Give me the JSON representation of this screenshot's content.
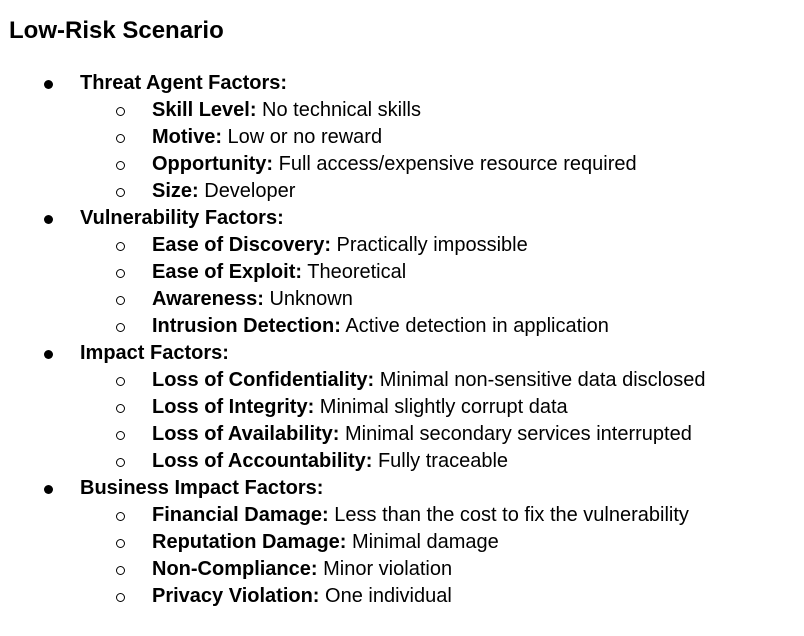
{
  "title": "Low-Risk Scenario",
  "sections": [
    {
      "heading": "Threat Agent Factors:",
      "items": [
        {
          "label": "Skill Level:",
          "value": " No technical skills"
        },
        {
          "label": "Motive:",
          "value": " Low or no reward"
        },
        {
          "label": "Opportunity:",
          "value": " Full access/expensive resource required"
        },
        {
          "label": "Size:",
          "value": " Developer"
        }
      ]
    },
    {
      "heading": "Vulnerability Factors:",
      "items": [
        {
          "label": "Ease of Discovery:",
          "value": " Practically impossible"
        },
        {
          "label": "Ease of Exploit:",
          "value": " Theoretical"
        },
        {
          "label": "Awareness:",
          "value": " Unknown"
        },
        {
          "label": "Intrusion Detection:",
          "value": " Active detection in application"
        }
      ]
    },
    {
      "heading": "Impact Factors:",
      "items": [
        {
          "label": "Loss of Confidentiality:",
          "value": " Minimal non-sensitive data disclosed"
        },
        {
          "label": "Loss of Integrity:",
          "value": " Minimal slightly corrupt data"
        },
        {
          "label": "Loss of Availability:",
          "value": " Minimal secondary services interrupted"
        },
        {
          "label": "Loss of Accountability:",
          "value": " Fully traceable"
        }
      ]
    },
    {
      "heading": "Business Impact Factors:",
      "items": [
        {
          "label": "Financial Damage:",
          "value": " Less than the cost to fix the vulnerability"
        },
        {
          "label": "Reputation Damage:",
          "value": " Minimal damage"
        },
        {
          "label": "Non-Compliance:",
          "value": " Minor violation"
        },
        {
          "label": "Privacy Violation:",
          "value": " One individual"
        }
      ]
    }
  ]
}
